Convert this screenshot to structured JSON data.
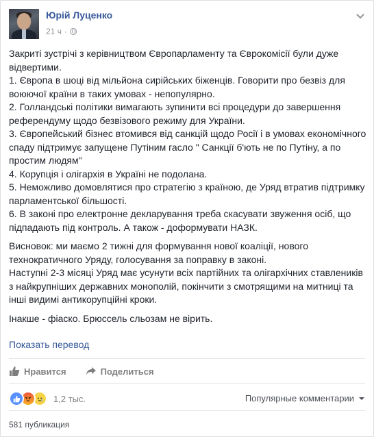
{
  "post": {
    "author": "Юрій Луценко",
    "time": "21 ч",
    "paragraphs": [
      "Закриті зустрічі з керівництвом Європарламенту та Єврокомісії були дуже відвертими.",
      "1. Європа в шоці від мільйона сирійських біженців. Говорити про безвіз для воюючої країни в таких умовах - непопулярно.",
      "2. Голландські політики вимагають зупинити всі процедури до завершення референдуму щодо безвізового режиму для України.",
      "3. Європейський бізнес втомився від санкцій щодо Росії і в умовах економічного спаду підтримує запущене Путіним гасло \" Санкції б'ють не по Путіну, а по простим людям\"",
      "4. Корупція і олігархія в Україні не подолана.",
      "5. Неможливо домовлятися про стратегію з країною, де Уряд втратив підтримку парламентської більшості.",
      "6. В законі про електронне декларування треба скасувати звуження осіб, що підпадають під контроль. А також - доформувати НАЗК.",
      "Висновок: ми маємо 2 тижні для формування нової коаліції, нового технократичного Уряду, голосування за поправку в законі.",
      "Наступні 2-3 місяці Уряд має усунути всіх партійних та олігархічних ставлеників з найкрупніших державних монополій, покінчити з смотрящими на митниці та інші видимі антикорупційні кроки.",
      "Інакше - фіаско. Брюссель сльозам не вірить."
    ],
    "translate_label": "Показать перевод"
  },
  "actions": {
    "like_label": "Нравится",
    "share_label": "Поделиться"
  },
  "reactions": {
    "count": "1,2 тыс.",
    "sort_label": "Популярные комментарии"
  },
  "footer": {
    "shares": "581 публикация"
  },
  "colors": {
    "link": "#365899",
    "like_reaction": "#5890ff"
  }
}
